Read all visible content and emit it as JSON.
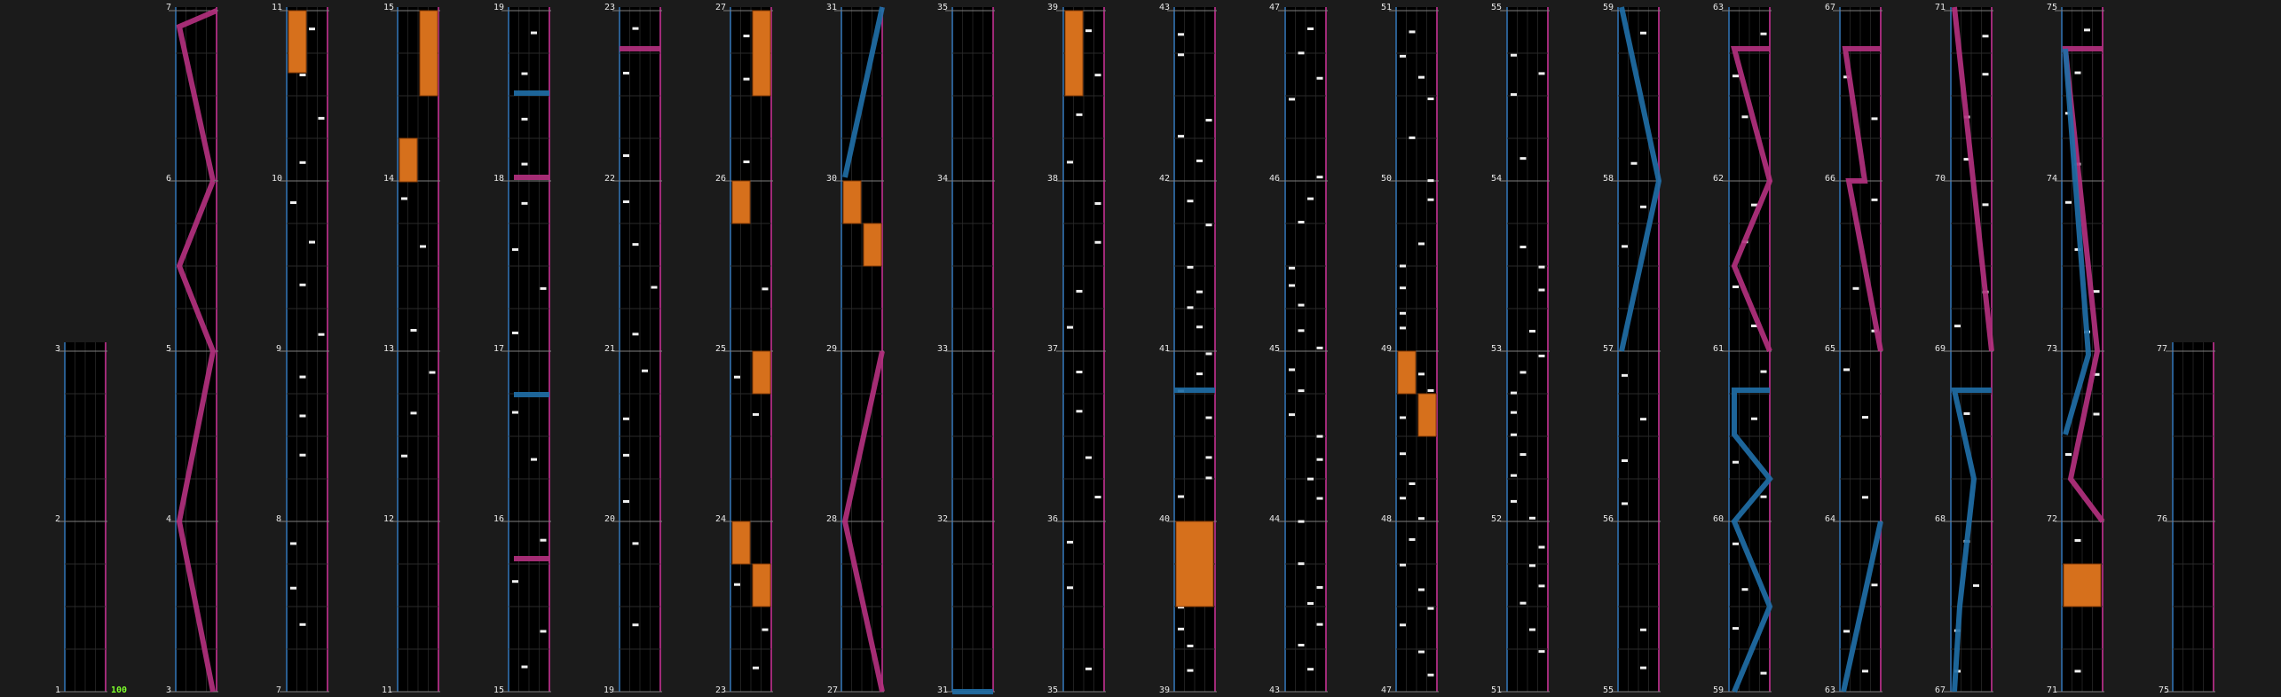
{
  "app": {
    "view": "chart-preview"
  },
  "columns": [
    {
      "bottom": "1",
      "top": "3"
    },
    {
      "bottom": "3",
      "top": "7"
    },
    {
      "bottom": "7",
      "top": "11"
    },
    {
      "bottom": "11",
      "top": "15"
    },
    {
      "bottom": "15",
      "top": "19"
    },
    {
      "bottom": "19",
      "top": "23"
    },
    {
      "bottom": "23",
      "top": "27"
    },
    {
      "bottom": "27",
      "top": "31"
    },
    {
      "bottom": "31",
      "top": "35"
    },
    {
      "bottom": "35",
      "top": "39"
    },
    {
      "bottom": "39",
      "top": "43"
    },
    {
      "bottom": "43",
      "top": "47"
    },
    {
      "bottom": "47",
      "top": "51"
    },
    {
      "bottom": "51",
      "top": "55"
    },
    {
      "bottom": "55",
      "top": "59"
    },
    {
      "bottom": "59",
      "top": "63"
    },
    {
      "bottom": "63",
      "top": "67"
    },
    {
      "bottom": "67",
      "top": "71"
    },
    {
      "bottom": "71",
      "top": "75"
    },
    {
      "bottom": "75",
      "top": "77"
    }
  ],
  "measure_labels": [
    "2",
    "4",
    "5",
    "6",
    "8",
    "9",
    "10",
    "12",
    "13",
    "14",
    "16",
    "17",
    "18",
    "20",
    "21",
    "22",
    "24",
    "25",
    "26",
    "28",
    "29",
    "30",
    "32",
    "33",
    "34",
    "36",
    "37",
    "38",
    "40",
    "41",
    "42",
    "44",
    "45",
    "46",
    "48",
    "49",
    "50",
    "52",
    "53",
    "54",
    "56",
    "57",
    "58",
    "60",
    "61",
    "62",
    "64",
    "65",
    "66",
    "68",
    "69",
    "70",
    "72",
    "73",
    "74",
    "76"
  ],
  "combo": {
    "value": "100"
  },
  "colors": {
    "background": "#1b1b1b",
    "lane": "#000000",
    "left_border": "#2a5d8f",
    "right_border": "#a02a78",
    "laser_left": "#1f6ea6",
    "laser_right": "#b2307e",
    "fx_hold": "#d6701c",
    "chip": "#f0f0f0",
    "measure_line": "#808080",
    "combo_text": "#7dff2a"
  }
}
